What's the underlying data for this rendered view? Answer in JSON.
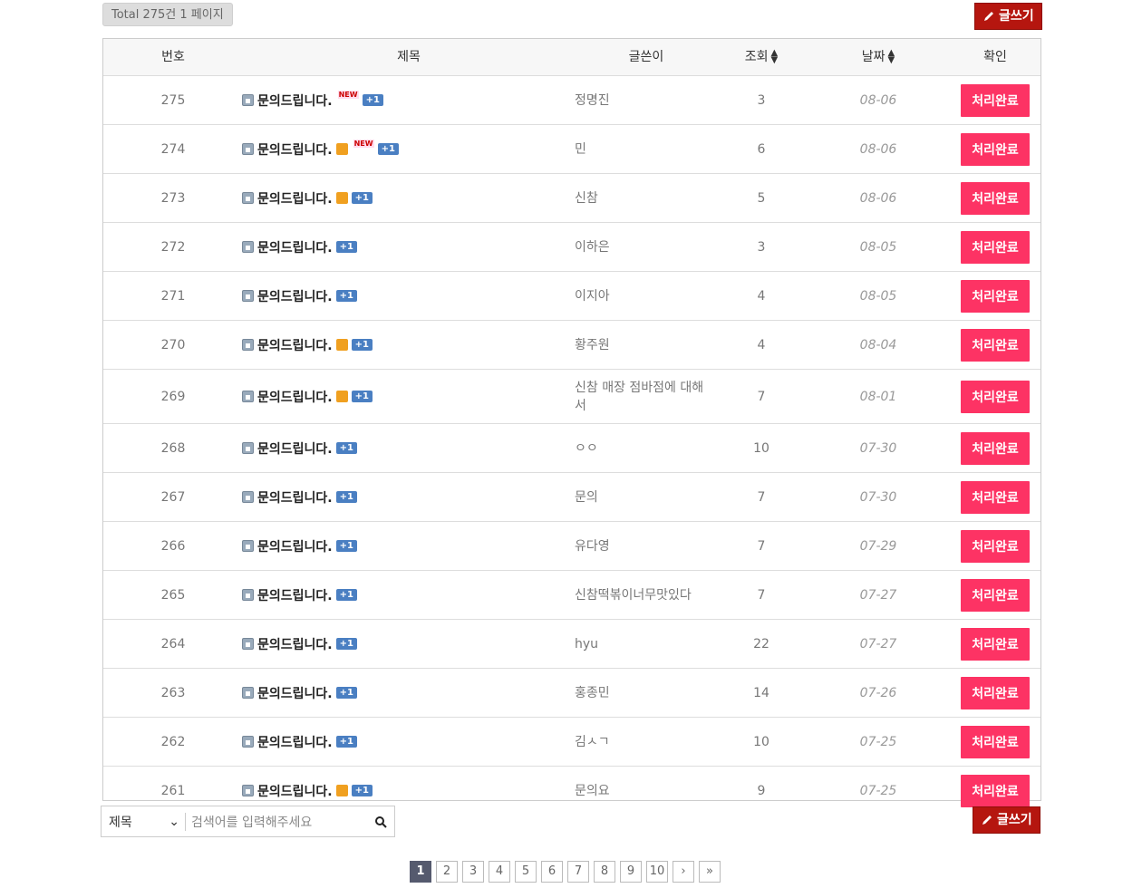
{
  "summary": {
    "total_label": "Total 275건 1 페이지"
  },
  "actions": {
    "write_label": "글쓰기"
  },
  "table": {
    "headers": {
      "num": "번호",
      "title": "제목",
      "writer": "글쓴이",
      "views": "조회",
      "date": "날짜",
      "confirm": "확인"
    },
    "rows": [
      {
        "num": "275",
        "title": "문의드립니다.",
        "file": false,
        "new": true,
        "comments": "+1",
        "writer": "정명진",
        "views": "3",
        "date": "08-06",
        "status": "처리완료"
      },
      {
        "num": "274",
        "title": "문의드립니다.",
        "file": true,
        "new": true,
        "comments": "+1",
        "writer": "민",
        "views": "6",
        "date": "08-06",
        "status": "처리완료"
      },
      {
        "num": "273",
        "title": "문의드립니다.",
        "file": true,
        "new": false,
        "comments": "+1",
        "writer": "신참",
        "views": "5",
        "date": "08-06",
        "status": "처리완료"
      },
      {
        "num": "272",
        "title": "문의드립니다.",
        "file": false,
        "new": false,
        "comments": "+1",
        "writer": "이하은",
        "views": "3",
        "date": "08-05",
        "status": "처리완료"
      },
      {
        "num": "271",
        "title": "문의드립니다.",
        "file": false,
        "new": false,
        "comments": "+1",
        "writer": "이지아",
        "views": "4",
        "date": "08-05",
        "status": "처리완료"
      },
      {
        "num": "270",
        "title": "문의드립니다.",
        "file": true,
        "new": false,
        "comments": "+1",
        "writer": "황주원",
        "views": "4",
        "date": "08-04",
        "status": "처리완료"
      },
      {
        "num": "269",
        "title": "문의드립니다.",
        "file": true,
        "new": false,
        "comments": "+1",
        "writer": "신참 매장 점바점에 대해서",
        "views": "7",
        "date": "08-01",
        "status": "처리완료"
      },
      {
        "num": "268",
        "title": "문의드립니다.",
        "file": false,
        "new": false,
        "comments": "+1",
        "writer": "ㅇㅇ",
        "views": "10",
        "date": "07-30",
        "status": "처리완료"
      },
      {
        "num": "267",
        "title": "문의드립니다.",
        "file": false,
        "new": false,
        "comments": "+1",
        "writer": "문의",
        "views": "7",
        "date": "07-30",
        "status": "처리완료"
      },
      {
        "num": "266",
        "title": "문의드립니다.",
        "file": false,
        "new": false,
        "comments": "+1",
        "writer": "유다영",
        "views": "7",
        "date": "07-29",
        "status": "처리완료"
      },
      {
        "num": "265",
        "title": "문의드립니다.",
        "file": false,
        "new": false,
        "comments": "+1",
        "writer": "신참떡볶이너무맛있다",
        "views": "7",
        "date": "07-27",
        "status": "처리완료"
      },
      {
        "num": "264",
        "title": "문의드립니다.",
        "file": false,
        "new": false,
        "comments": "+1",
        "writer": "hyu",
        "views": "22",
        "date": "07-27",
        "status": "처리완료"
      },
      {
        "num": "263",
        "title": "문의드립니다.",
        "file": false,
        "new": false,
        "comments": "+1",
        "writer": "홍종민",
        "views": "14",
        "date": "07-26",
        "status": "처리완료"
      },
      {
        "num": "262",
        "title": "문의드립니다.",
        "file": false,
        "new": false,
        "comments": "+1",
        "writer": "김ㅅㄱ",
        "views": "10",
        "date": "07-25",
        "status": "처리완료"
      },
      {
        "num": "261",
        "title": "문의드립니다.",
        "file": true,
        "new": false,
        "comments": "+1",
        "writer": "문의요",
        "views": "9",
        "date": "07-25",
        "status": "처리완료"
      }
    ]
  },
  "badges": {
    "new_label": "NEW"
  },
  "search": {
    "field_selected": "제목",
    "placeholder": "검색어를 입력해주세요"
  },
  "pagination": {
    "pages": [
      "1",
      "2",
      "3",
      "4",
      "5",
      "6",
      "7",
      "8",
      "9",
      "10"
    ],
    "current": "1",
    "next_label": "›",
    "last_label": "»"
  },
  "colors": {
    "accent": "#fd3364",
    "write_button": "#b5160f",
    "comment_badge": "#4a7fc2",
    "active_page": "#555a6e"
  }
}
